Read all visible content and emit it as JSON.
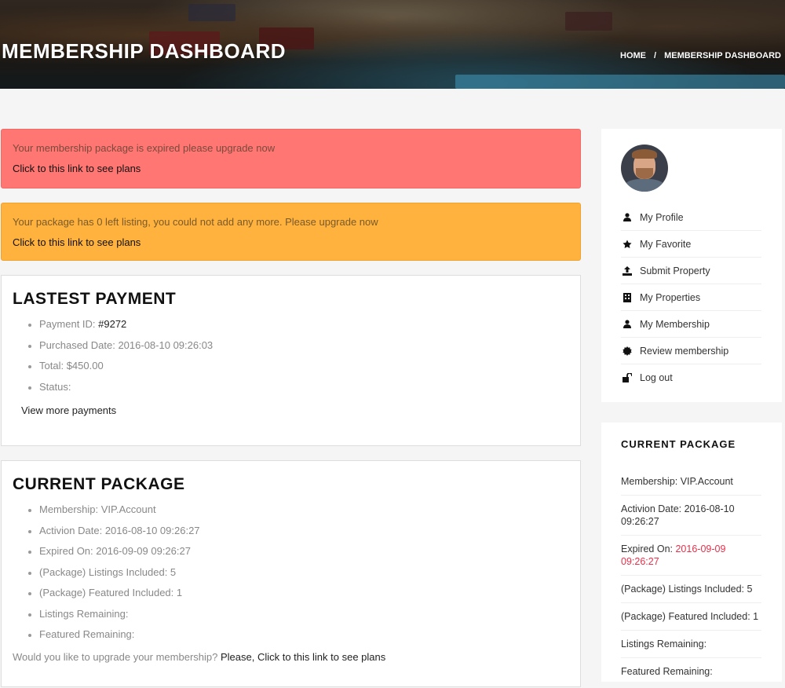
{
  "header": {
    "title": "MEMBERSHIP DASHBOARD",
    "breadcrumb": [
      "HOME",
      "/",
      "MEMBERSHIP DASHBOARD"
    ]
  },
  "alerts": [
    {
      "message": "Your membership package is expired please upgrade now",
      "link": "Click to this link to see plans"
    },
    {
      "message": "Your package has 0 left listing, you could not add any more. Please upgrade now",
      "link": "Click to this link to see plans"
    }
  ],
  "latest_payment": {
    "title": "LASTEST PAYMENT",
    "items": [
      {
        "label": "Payment ID: ",
        "value": "#9272"
      },
      {
        "label": "Purchased Date: ",
        "value": "2016-08-10 09:26:03"
      },
      {
        "label": "Total: ",
        "value": "$450.00"
      },
      {
        "label": "Status: ",
        "value": ""
      }
    ],
    "view_more": "View more payments"
  },
  "current_package": {
    "title": "CURRENT PACKAGE",
    "items": [
      "Membership: VIP.Account",
      "Activion Date: 2016-08-10 09:26:27",
      "Expired On: 2016-09-09 09:26:27",
      "(Package) Listings Included: 5",
      "(Package) Featured Included: 1",
      "Listings Remaining:",
      "Featured Remaining:"
    ],
    "upgrade_question": "Would you like to upgrade your membership?",
    "upgrade_link": "Please, Click to this link to see plans"
  },
  "sidebar": {
    "menu": [
      {
        "label": "My Profile",
        "icon": "user-icon"
      },
      {
        "label": "My Favorite",
        "icon": "star-icon"
      },
      {
        "label": "Submit Property",
        "icon": "upload-icon"
      },
      {
        "label": "My Properties",
        "icon": "building-icon"
      },
      {
        "label": "My Membership",
        "icon": "user-icon"
      },
      {
        "label": "Review membership",
        "icon": "certificate-icon"
      },
      {
        "label": "Log out",
        "icon": "unlock-icon"
      }
    ],
    "package": {
      "title": "CURRENT PACKAGE",
      "membership": "Membership: VIP.Account",
      "activation": "Activion Date: 2016-08-10 09:26:27",
      "expired_label": "Expired On: ",
      "expired_value": "2016-09-09 09:26:27",
      "listings_included": "(Package) Listings Included: 5",
      "featured_included": "(Package) Featured Included: 1",
      "listings_remaining": "Listings Remaining:",
      "featured_remaining": "Featured Remaining:"
    }
  },
  "colors": {
    "alert_red": "#ff7673",
    "alert_orange": "#ffb23e",
    "expired_red": "#e8304a"
  }
}
